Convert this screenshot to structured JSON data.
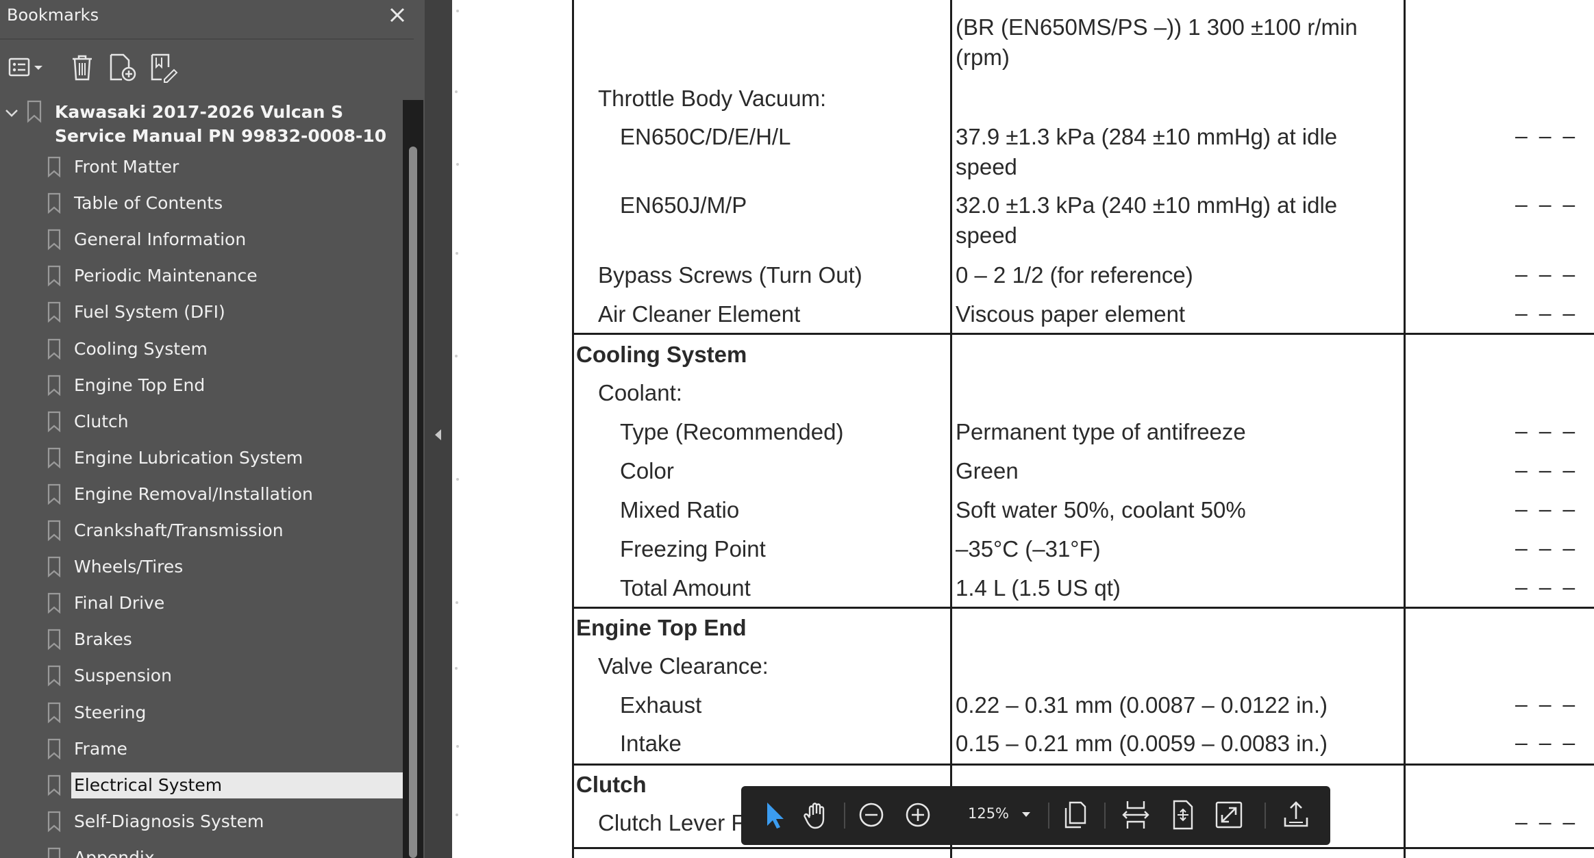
{
  "sidebar": {
    "title": "Bookmarks",
    "root": {
      "label": "Kawasaki 2017-2026 Vulcan S Service Manual PN 99832-0008-10"
    },
    "items": [
      {
        "label": "Front Matter"
      },
      {
        "label": "Table of Contents"
      },
      {
        "label": "General Information"
      },
      {
        "label": "Periodic Maintenance"
      },
      {
        "label": "Fuel System (DFI)"
      },
      {
        "label": "Cooling System"
      },
      {
        "label": "Engine Top End"
      },
      {
        "label": "Clutch"
      },
      {
        "label": "Engine Lubrication System"
      },
      {
        "label": "Engine Removal/Installation"
      },
      {
        "label": "Crankshaft/Transmission"
      },
      {
        "label": "Wheels/Tires"
      },
      {
        "label": "Final Drive"
      },
      {
        "label": "Brakes"
      },
      {
        "label": "Suspension"
      },
      {
        "label": "Steering"
      },
      {
        "label": "Frame"
      },
      {
        "label": "Electrical System"
      },
      {
        "label": "Self-Diagnosis System"
      },
      {
        "label": "Appendix"
      }
    ],
    "selected": "Electrical System"
  },
  "document": {
    "rows": [
      {
        "col1": "",
        "col2": "(BR (EN650MS/PS –)) 1 300 ±100 r/min",
        "col3": ""
      },
      {
        "col1": "",
        "col2": "(rpm)",
        "col3": ""
      },
      {
        "col1": "Throttle Body Vacuum:",
        "col2": "",
        "col3": ""
      },
      {
        "col1": "EN650C/D/E/H/L",
        "col2": "37.9 ±1.3 kPa (284 ±10 mmHg) at idle",
        "col3": "– – –"
      },
      {
        "col1": "",
        "col2": "speed",
        "col3": ""
      },
      {
        "col1": "EN650J/M/P",
        "col2": "32.0 ±1.3 kPa (240 ±10 mmHg) at idle",
        "col3": "– – –"
      },
      {
        "col1": "",
        "col2": "speed",
        "col3": ""
      },
      {
        "col1": "Bypass Screws (Turn Out)",
        "col2": "0 – 2 1/2 (for reference)",
        "col3": "– – –"
      },
      {
        "col1": "Air Cleaner Element",
        "col2": "Viscous paper element",
        "col3": "– – –"
      },
      {
        "col1": "Cooling System",
        "col2": "",
        "col3": ""
      },
      {
        "col1": "Coolant:",
        "col2": "",
        "col3": ""
      },
      {
        "col1": "Type (Recommended)",
        "col2": "Permanent type of antifreeze",
        "col3": "– – –"
      },
      {
        "col1": "Color",
        "col2": "Green",
        "col3": "– – –"
      },
      {
        "col1": "Mixed Ratio",
        "col2": "Soft water 50%, coolant 50%",
        "col3": "– – –"
      },
      {
        "col1": "Freezing Point",
        "col2": "–35°C (–31°F)",
        "col3": "– – –"
      },
      {
        "col1": "Total Amount",
        "col2": "1.4 L (1.5 US qt)",
        "col3": "– – –"
      },
      {
        "col1": "Engine Top End",
        "col2": "",
        "col3": ""
      },
      {
        "col1": "Valve Clearance:",
        "col2": "",
        "col3": ""
      },
      {
        "col1": "Exhaust",
        "col2": "0.22 – 0.31 mm (0.0087 – 0.0122 in.)",
        "col3": "– – –"
      },
      {
        "col1": "Intake",
        "col2": "0.15 – 0.21 mm (0.0059 – 0.0083 in.)",
        "col3": "– – –"
      },
      {
        "col1": "Clutch",
        "col2": "",
        "col3": ""
      },
      {
        "col1": "Clutch Lever F",
        "col2": "",
        "col3": "– – –"
      }
    ]
  },
  "floating_toolbar": {
    "zoom": "125%",
    "icons": [
      "select-arrow-icon",
      "hand-icon",
      "zoom-out-icon",
      "zoom-in-icon",
      "page-view-icon",
      "fit-width-icon",
      "fit-page-icon",
      "full-screen-icon",
      "share-icon"
    ]
  },
  "colors": {
    "sidebar_bg": "#535353",
    "accent_blue": "#3b9cf0",
    "selected_bg": "#e9e9e9",
    "toolbar_bg": "#232323"
  }
}
